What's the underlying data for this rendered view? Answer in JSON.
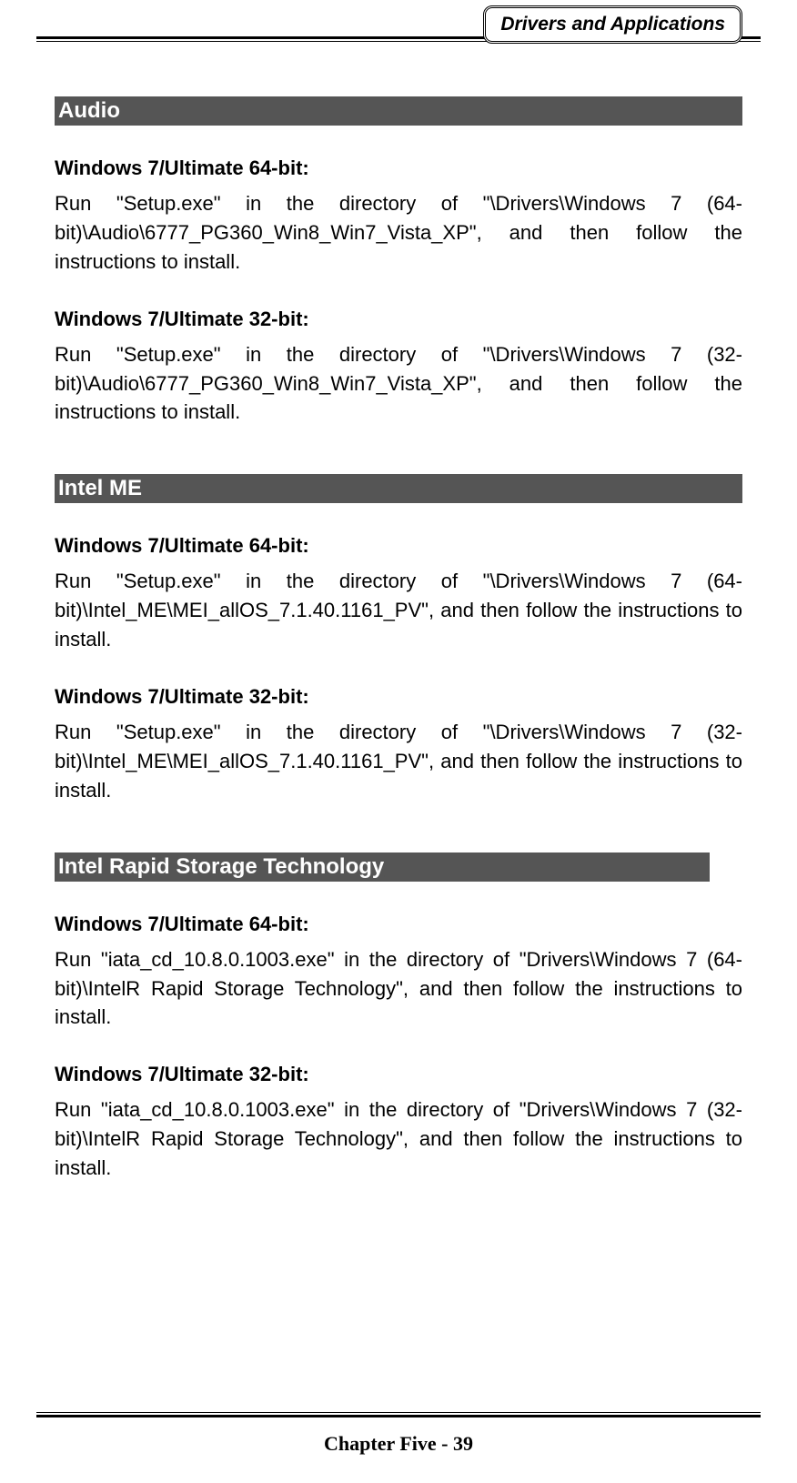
{
  "header": {
    "badge": "Drivers and Applications"
  },
  "sections": [
    {
      "title": "Audio",
      "blocks": [
        {
          "heading": "Windows 7/Ultimate 64-bit:",
          "body": "Run \"Setup.exe\" in the directory of \"\\Drivers\\Windows 7 (64-bit)\\Audio\\6777_PG360_Win8_Win7_Vista_XP\", and then follow the instructions to install."
        },
        {
          "heading": "Windows 7/Ultimate 32-bit:",
          "body": "Run \"Setup.exe\" in the directory of \"\\Drivers\\Windows 7 (32-bit)\\Audio\\6777_PG360_Win8_Win7_Vista_XP\", and then follow the instructions to install."
        }
      ]
    },
    {
      "title": "Intel ME",
      "blocks": [
        {
          "heading": "Windows 7/Ultimate 64-bit:",
          "body": "Run \"Setup.exe\" in the directory of \"\\Drivers\\Windows 7 (64-bit)\\Intel_ME\\MEI_allOS_7.1.40.1161_PV\", and then follow the instructions to install."
        },
        {
          "heading": "Windows 7/Ultimate 32-bit:",
          "body": "Run \"Setup.exe\" in the directory of \"\\Drivers\\Windows 7 (32-bit)\\Intel_ME\\MEI_allOS_7.1.40.1161_PV\", and then follow the instructions to install."
        }
      ]
    },
    {
      "title": "Intel Rapid Storage Technology",
      "short_bar": true,
      "blocks": [
        {
          "heading": "Windows 7/Ultimate 64-bit:",
          "body": "Run \"iata_cd_10.8.0.1003.exe\" in the directory of \"Drivers\\Windows 7 (64-bit)\\IntelR Rapid Storage Technology\", and then follow the instructions to install."
        },
        {
          "heading": "Windows 7/Ultimate 32-bit:",
          "body": "Run \"iata_cd_10.8.0.1003.exe\" in the directory of \"Drivers\\Windows 7 (32-bit)\\IntelR Rapid Storage Technology\", and then follow the instructions to install."
        }
      ]
    }
  ],
  "footer": {
    "text": "Chapter Five - 39"
  }
}
